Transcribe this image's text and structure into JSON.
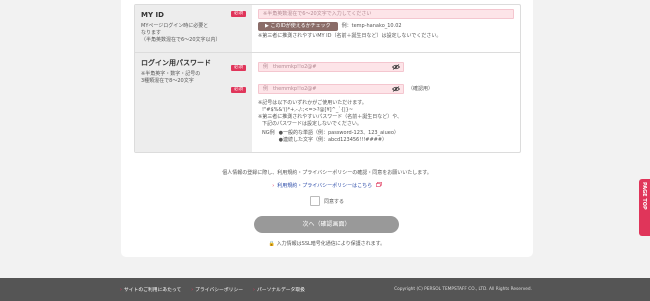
{
  "form": {
    "id": {
      "title": "MY ID",
      "required": "必須",
      "desc1": "MYページログイン時に必要と",
      "desc2": "なります",
      "desc3": "（半角英数混在で6～20文字以内）",
      "placeholder": "※半角英数混在で6～20文字で入力してください",
      "check_button": "このIDが使えるかチェック",
      "example": "例：temp-hanako_10.02",
      "note": "※第三者に推測されやすいMY ID（名前＋誕生日など）は設定しないでください。"
    },
    "password": {
      "title": "ログイン用パスワード",
      "required": "必須",
      "desc1": "※半角英字・数字・記号の",
      "desc2": "3種類混在で8～20文字",
      "placeholder1": "例　themmkp!!o2@#",
      "placeholder2": "例　themmkp!!o2@#",
      "confirm": "（確認用）",
      "note1": "※記号は以下のいずれかがご使用いただけます。",
      "note2": "!\"#$%&'()*+,-./:;<=>?@[¥]^_`{|}~",
      "note3": "※第三者に推測されやすいパスワード（名前＋誕生日など）や、",
      "note4": "下記のパスワードは設定しないでください。",
      "ng_label": "NG例",
      "ng1": "●一般的な単語（例：password-123、123_aiueo）",
      "ng2": "●連続した文字（例：abcd123456!!!####）"
    }
  },
  "notice": "個人情報の登録に際し、利用規約・プライバシーポリシーの確認・同意をお願いいたします。",
  "terms_link": "利用規約・プライバシーポリシーはこちら",
  "agree_label": "同意する",
  "next_button": "次へ（確認画面）",
  "ssl_note": "入力情報はSSL暗号化通信により保護されます。",
  "footer": {
    "links": [
      "サイトのご利用にあたって",
      "プライバシーポリシー",
      "パーソナルデータ取扱"
    ],
    "copyright": "Copyright (C) PERSOL TEMPSTAFF CO., LTD. All Rights Reserved."
  },
  "page_top": "PAGE TOP",
  "colors": {
    "accent": "#e0355a",
    "button": "#8a6c68",
    "next": "#999999",
    "footer": "#555555"
  }
}
